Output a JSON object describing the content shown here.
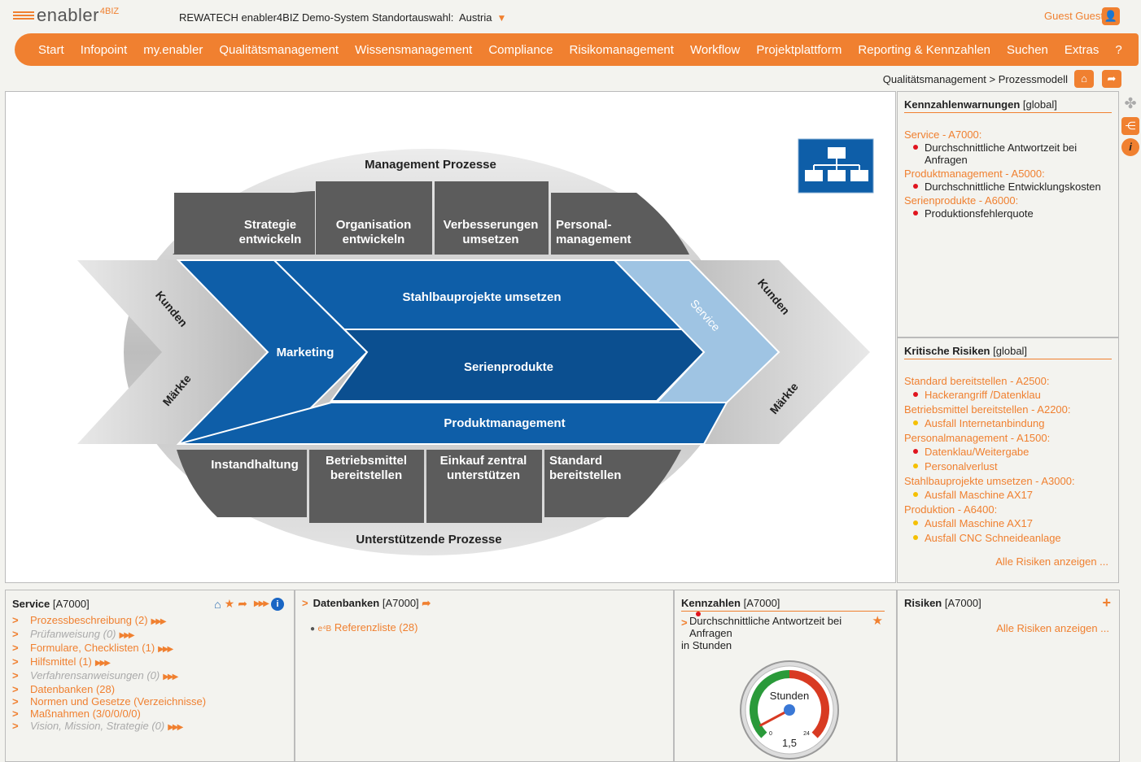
{
  "header": {
    "logo_text": "enabler",
    "logo_sup": "4BIZ",
    "system_title": "REWATECH enabler4BIZ Demo-System Standortauswahl:",
    "country": "Austria",
    "user": "Guest Guest"
  },
  "nav": [
    "Start",
    "Infopoint",
    "my.enabler",
    "Qualitätsmanagement",
    "Wissensmanagement",
    "Compliance",
    "Risikomanagement",
    "Workflow",
    "Projektplattform",
    "Reporting & Kennzahlen",
    "Suchen",
    "Extras",
    "?"
  ],
  "breadcrumb": "Qualitätsmanagement > Prozessmodell",
  "model": {
    "management_title": "Management Prozesse",
    "management": [
      "Strategie|entwickeln",
      "Organisation|entwickeln",
      "Verbesserungen|umsetzen",
      "Personal-|management"
    ],
    "support_title": "Unterstützende Prozesse",
    "support": [
      "Instandhaltung",
      "Betriebsmittel|bereitstellen",
      "Einkauf zentral|unterstützen",
      "Standard|bereitstellen"
    ],
    "left_top": "Kunden",
    "left_bottom": "Märkte",
    "right_top": "Kunden",
    "right_bottom": "Märkte",
    "marketing": "Marketing",
    "core": [
      "Stahlbauprojekte umsetzen",
      "Serienprodukte",
      "Produktmanagement"
    ],
    "service": "Service"
  },
  "warnings": {
    "title": "Kennzahlenwarnungen",
    "tag": "[global]",
    "groups": [
      {
        "head": "Service - A7000:",
        "items": [
          "Durchschnittliche Antwortzeit bei Anfragen"
        ]
      },
      {
        "head": "Produktmanagement - A5000:",
        "items": [
          "Durchschnittliche Entwicklungskosten"
        ]
      },
      {
        "head": "Serienprodukte - A6000:",
        "items": [
          "Produktionsfehlerquote"
        ]
      }
    ]
  },
  "risks": {
    "title": "Kritische Risiken",
    "tag": "[global]",
    "groups": [
      {
        "head": "Standard bereitstellen - A2500:",
        "items": [
          [
            "Hackerangriff /Datenklau",
            "#e0141e"
          ]
        ]
      },
      {
        "head": "Betriebsmittel bereitstellen - A2200:",
        "items": [
          [
            "Ausfall Internetanbindung",
            "#f5c000"
          ]
        ]
      },
      {
        "head": "Personalmanagement - A1500:",
        "items": [
          [
            "Datenklau/Weitergabe",
            "#e0141e"
          ],
          [
            "Personalverlust",
            "#f5c000"
          ]
        ]
      },
      {
        "head": "Stahlbauprojekte umsetzen - A3000:",
        "items": [
          [
            "Ausfall Maschine AX17",
            "#f5c000"
          ]
        ]
      },
      {
        "head": "Produktion - A6400:",
        "items": [
          [
            "Ausfall Maschine AX17",
            "#f5c000"
          ],
          [
            "Ausfall CNC Schneideanlage",
            "#f5c000"
          ]
        ]
      }
    ],
    "more": "Alle Risiken anzeigen ..."
  },
  "service_box": {
    "title": "Service",
    "tag": "[A7000]",
    "rows": [
      {
        "label": "Prozessbeschreibung (2)",
        "dim": false,
        "arrows": true
      },
      {
        "label": "Prüfanweisung (0)",
        "dim": true,
        "arrows": true
      },
      {
        "label": "Formulare, Checklisten (1)",
        "dim": false,
        "arrows": true
      },
      {
        "label": "Hilfsmittel (1)",
        "dim": false,
        "arrows": true
      },
      {
        "label": "Verfahrensanweisungen (0)",
        "dim": true,
        "arrows": true
      },
      {
        "label": "Datenbanken (28)",
        "dim": false,
        "arrows": false
      },
      {
        "label": "Normen und Gesetze (Verzeichnisse)",
        "dim": false,
        "arrows": false
      },
      {
        "label": "Maßnahmen (3/0/0/0/0)",
        "dim": false,
        "arrows": false
      },
      {
        "label": "Vision, Mission, Strategie (0)",
        "dim": true,
        "arrows": true
      }
    ]
  },
  "db_box": {
    "title": "Datenbanken",
    "tag": "[A7000]",
    "item_prefix": "e⁴B",
    "item": "Referenzliste (28)"
  },
  "kpi_box": {
    "title": "Kennzahlen",
    "tag": "[A7000]",
    "name": "Durchschnittliche Antwortzeit bei Anfragen",
    "unit": "in Stunden",
    "gauge_label": "Stunden",
    "gauge_min": "0",
    "gauge_max": "24",
    "value": "1,5",
    "value_num": 1.5
  },
  "risk_box": {
    "title": "Risiken",
    "tag": "[A7000]",
    "more": "Alle Risiken anzeigen ..."
  },
  "colors": {
    "accent": "#f08030",
    "blue": "#0e5ea8",
    "blue_dark": "#0b4f90",
    "service": "#9fc4e3",
    "gray_box": "#5c5c5c"
  }
}
